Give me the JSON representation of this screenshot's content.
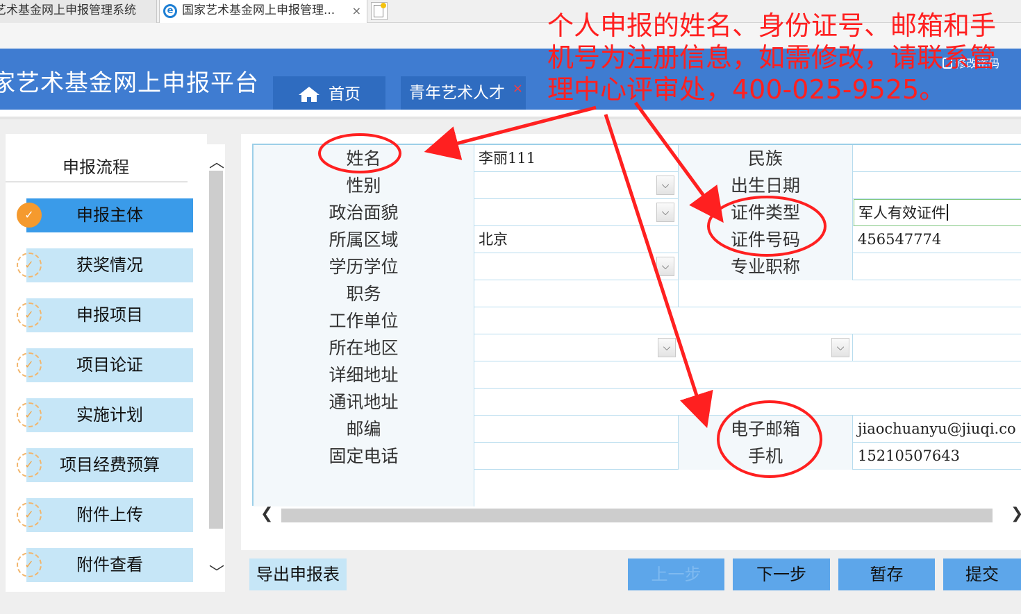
{
  "browser": {
    "tabs": [
      {
        "label": "艺术基金网上申报管理系统"
      },
      {
        "label": "国家艺术基金网上申报管理...",
        "close": "×"
      }
    ],
    "ie_glyph": "e"
  },
  "header": {
    "app_title": "家艺术基金网上申报平台",
    "nav_tabs": [
      {
        "label": "首页",
        "icon": "home-icon"
      },
      {
        "label": "青年艺术人才",
        "close": "×"
      }
    ],
    "change_password": "修改密码"
  },
  "sidebar": {
    "title": "申报流程",
    "steps": [
      {
        "label": "申报主体",
        "active": true
      },
      {
        "label": "获奖情况"
      },
      {
        "label": "申报项目"
      },
      {
        "label": "项目论证"
      },
      {
        "label": "实施计划"
      },
      {
        "label": "项目经费预算"
      },
      {
        "label": "附件上传"
      },
      {
        "label": "附件查看"
      }
    ],
    "step_glyph": "✓",
    "scroll_up": "︿",
    "scroll_down": "﹀"
  },
  "form": {
    "name_label": "姓名",
    "name_value": "李丽111",
    "ethnicity_label": "民族",
    "ethnicity_value": "",
    "gender_label": "性别",
    "birthdate_label": "出生日期",
    "birthdate_value": "",
    "political_label": "政治面貌",
    "id_type_label": "证件类型",
    "id_type_value": "军人有效证件",
    "region_label": "所属区域",
    "region_value": "北京",
    "id_number_label": "证件号码",
    "id_number_value": "456547774",
    "education_label": "学历学位",
    "title_label": "专业职称",
    "title_value": "",
    "position_label": "职务",
    "position_value": "",
    "employer_label": "工作单位",
    "employer_value": "",
    "location_label": "所在地区",
    "address_label": "详细地址",
    "address_value": "",
    "mailing_label": "通讯地址",
    "mailing_value": "",
    "postcode_label": "邮编",
    "postcode_value": "",
    "email_label": "电子邮箱",
    "email_value": "jiaochuanyu@jiuqi.co",
    "phone_label": "固定电话",
    "phone_value": "",
    "mobile_label": "手机",
    "mobile_value": "15210507643",
    "dropdown_glyph": "⌵"
  },
  "hscroll": {
    "left": "❮",
    "right": "❯"
  },
  "buttons": {
    "export": "导出申报表",
    "prev": "上一步",
    "next": "下一步",
    "save": "暂存",
    "submit": "提交"
  },
  "annotation": {
    "text": "个人申报的姓名、身份证号、邮箱和手机号为注册信息，如需修改，请联系管理中心评审处，400-025-9525。",
    "color": "#ff2020"
  },
  "colors": {
    "header_blue": "#3f7cd1",
    "tab_blue": "#2f6cc0",
    "step_light": "#c6e6f7",
    "step_active": "#3a9be9",
    "button_blue": "#5da6ea",
    "done_orange": "#f59a2e"
  }
}
